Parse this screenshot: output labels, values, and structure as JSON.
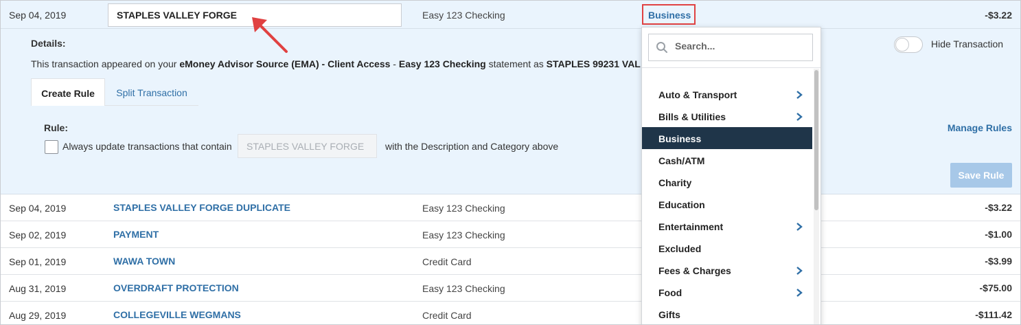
{
  "top_row": {
    "date": "Sep 04, 2019",
    "description_value": "STAPLES VALLEY FORGE",
    "account": "Easy 123 Checking",
    "category": "Business",
    "amount": "-$3.22"
  },
  "details": {
    "label": "Details:",
    "text_prefix": "This transaction appeared on your ",
    "source": "eMoney Advisor Source (EMA) - Client Access",
    "text_sep": " - ",
    "account": "Easy 123 Checking",
    "text_mid": " statement as ",
    "statement_name": "STAPLES 99231 VAL",
    "hide_label": "Hide Transaction",
    "tabs": [
      {
        "label": "Create Rule"
      },
      {
        "label": "Split Transaction"
      }
    ],
    "rule_label": "Rule:",
    "rule_text_before": "Always update transactions that contain",
    "rule_input_value": "STAPLES VALLEY FORGE",
    "rule_text_after": "with the Description and Category above",
    "manage_rules": "Manage Rules",
    "save_rule": "Save Rule"
  },
  "dropdown": {
    "search_placeholder": "Search...",
    "items": [
      {
        "label": "Auto & Transport",
        "has_children": true
      },
      {
        "label": "Bills & Utilities",
        "has_children": true
      },
      {
        "label": "Business",
        "selected": true
      },
      {
        "label": "Cash/ATM"
      },
      {
        "label": "Charity"
      },
      {
        "label": "Education"
      },
      {
        "label": "Entertainment",
        "has_children": true
      },
      {
        "label": "Excluded"
      },
      {
        "label": "Fees & Charges",
        "has_children": true
      },
      {
        "label": "Food",
        "has_children": true
      },
      {
        "label": "Gifts"
      }
    ]
  },
  "transactions": [
    {
      "date": "Sep 04, 2019",
      "description": "STAPLES VALLEY FORGE DUPLICATE",
      "account": "Easy 123 Checking",
      "amount": "-$3.22"
    },
    {
      "date": "Sep 02, 2019",
      "description": "PAYMENT",
      "account": "Easy 123 Checking",
      "amount": "-$1.00"
    },
    {
      "date": "Sep 01, 2019",
      "description": "WAWA TOWN",
      "account": "Credit Card",
      "amount": "-$3.99"
    },
    {
      "date": "Aug 31, 2019",
      "description": "OVERDRAFT PROTECTION",
      "account": "Easy 123 Checking",
      "amount": "-$75.00"
    },
    {
      "date": "Aug 29, 2019",
      "description": "COLLEGEVILLE WEGMANS",
      "account": "Credit Card",
      "amount": "-$111.42"
    }
  ],
  "colors": {
    "link": "#2f6fa6",
    "highlight_border": "#e04141",
    "selected_bg": "#1f3549",
    "panel_bg": "#eaf4fd",
    "save_button_bg": "#a7c8e8"
  },
  "icons": {
    "search": "search-icon",
    "chevron": "chevron-right-icon",
    "annotation_arrow": "arrow-icon"
  }
}
